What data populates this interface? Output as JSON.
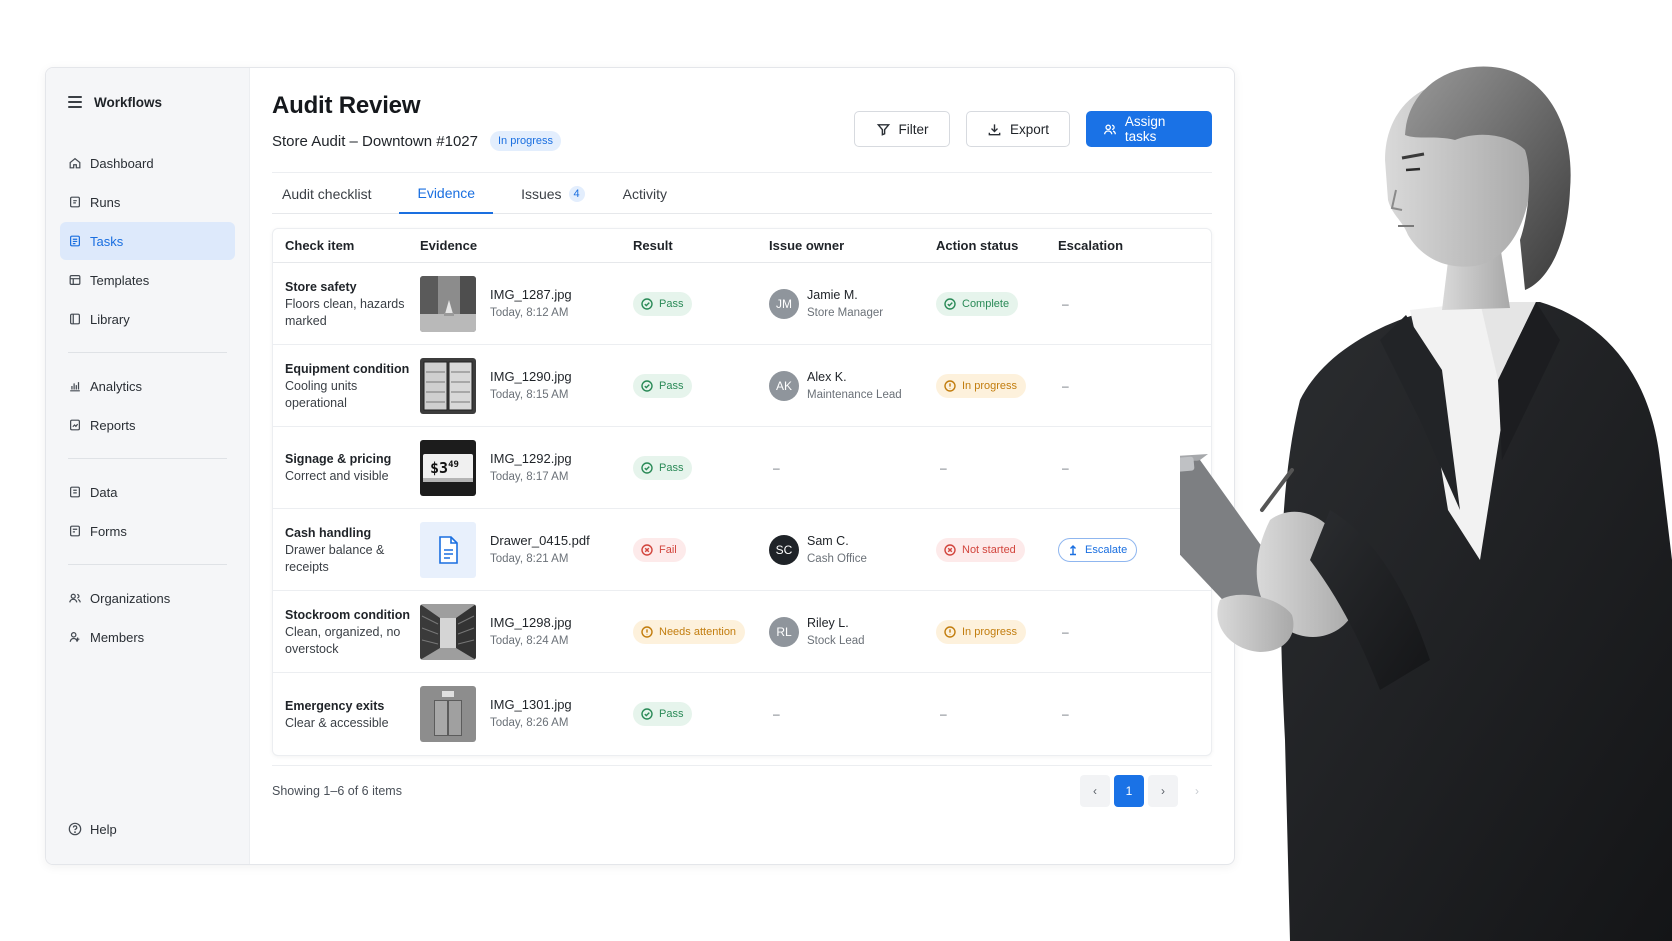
{
  "sidebar": {
    "title": "Workflows",
    "groups": [
      [
        {
          "label": "Dashboard",
          "icon": "home-icon"
        },
        {
          "label": "Runs",
          "icon": "runs-icon"
        },
        {
          "label": "Tasks",
          "icon": "tasks-icon",
          "active": true
        },
        {
          "label": "Templates",
          "icon": "templates-icon"
        },
        {
          "label": "Library",
          "icon": "library-icon"
        }
      ],
      [
        {
          "label": "Analytics",
          "icon": "analytics-icon"
        },
        {
          "label": "Reports",
          "icon": "reports-icon"
        }
      ],
      [
        {
          "label": "Data",
          "icon": "data-icon"
        },
        {
          "label": "Forms",
          "icon": "forms-icon"
        }
      ],
      [
        {
          "label": "Organizations",
          "icon": "organizations-icon"
        },
        {
          "label": "Members",
          "icon": "members-icon"
        }
      ]
    ],
    "help_label": "Help"
  },
  "header": {
    "title": "Audit Review",
    "subtitle": "Store Audit – Downtown #1027",
    "status_badge": "In progress",
    "filter_label": "Filter",
    "export_label": "Export",
    "assign_label": "Assign tasks"
  },
  "tabs": [
    {
      "label": "Audit checklist"
    },
    {
      "label": "Evidence",
      "active": true
    },
    {
      "label": "Issues",
      "count": "4"
    },
    {
      "label": "Activity"
    }
  ],
  "table": {
    "columns": [
      "Check item",
      "Evidence",
      "Result",
      "Issue owner",
      "Action status",
      "Escalation"
    ],
    "rows": [
      {
        "item": "Store safety",
        "desc": "Floors clean, hazards marked",
        "file": "IMG_1287.jpg",
        "time": "Today, 8:12 AM",
        "thumb": "aisle",
        "result": "Pass",
        "result_tone": "green",
        "initials": "JM",
        "owner": "Jamie M.",
        "role": "Store Manager",
        "action": "Complete",
        "action_tone": "green",
        "escalation": "–"
      },
      {
        "item": "Equipment condition",
        "desc": "Cooling units operational",
        "file": "IMG_1290.jpg",
        "time": "Today, 8:15 AM",
        "thumb": "cooler",
        "result": "Pass",
        "result_tone": "green",
        "initials": "AK",
        "owner": "Alex K.",
        "role": "Maintenance Lead",
        "action": "In progress",
        "action_tone": "amber",
        "escalation": "–"
      },
      {
        "item": "Signage & pricing",
        "desc": "Correct and visible",
        "file": "IMG_1292.jpg",
        "time": "Today, 8:17 AM",
        "thumb": "price",
        "price_text": "$3",
        "price_cents": "49",
        "result": "Pass",
        "result_tone": "green",
        "owner_dash": "–",
        "action_dash": "–",
        "escalation": "–"
      },
      {
        "item": "Cash handling",
        "desc": "Drawer balance & receipts",
        "file": "Drawer_0415.pdf",
        "time": "Today, 8:21 AM",
        "thumb": "pdf",
        "result": "Fail",
        "result_tone": "red",
        "initials": "SC",
        "owner": "Sam C.",
        "role": "Cash Office",
        "avatar_dark": true,
        "action": "Not started",
        "action_tone": "red",
        "escalation_button": "Escalate"
      },
      {
        "item": "Stockroom condition",
        "desc": "Clean, organized, no overstock",
        "file": "IMG_1298.jpg",
        "time": "Today, 8:24 AM",
        "thumb": "stockroom",
        "result": "Needs attention",
        "result_tone": "amber",
        "initials": "RL",
        "owner": "Riley L.",
        "role": "Stock Lead",
        "action": "In progress",
        "action_tone": "amber",
        "escalation": "–"
      },
      {
        "item": "Emergency exits",
        "desc": "Clear & accessible",
        "file": "IMG_1301.jpg",
        "time": "Today, 8:26 AM",
        "thumb": "exit",
        "result": "Pass",
        "result_tone": "green",
        "owner_dash": "–",
        "action_dash": "–",
        "escalation": "–"
      }
    ]
  },
  "footer": {
    "showing": "Showing 1–6 of 6 items",
    "current_page": "1",
    "prev_icon": "‹",
    "next_icon": "›"
  },
  "colors": {
    "accent": "#1a72e6",
    "pass": "#2a8a57",
    "fail": "#d2453d",
    "warning": "#c27d0e"
  }
}
